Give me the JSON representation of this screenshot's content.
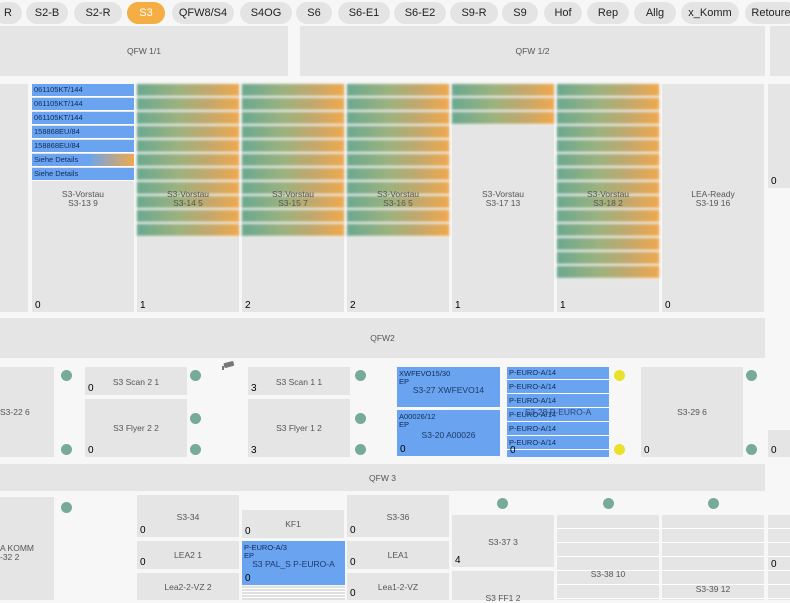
{
  "tabs": [
    {
      "label": "R"
    },
    {
      "label": "S2-B"
    },
    {
      "label": "S2-R"
    },
    {
      "label": "S3",
      "active": true
    },
    {
      "label": "QFW8/S4"
    },
    {
      "label": "S4OG"
    },
    {
      "label": "S6"
    },
    {
      "label": "S6-E1"
    },
    {
      "label": "S6-E2"
    },
    {
      "label": "S9-R"
    },
    {
      "label": "S9"
    },
    {
      "label": "Hof"
    },
    {
      "label": "Rep"
    },
    {
      "label": "Allg"
    },
    {
      "label": "x_Komm"
    },
    {
      "label": "Retoure"
    }
  ],
  "zones": {
    "qfw11": "QFW 1/1",
    "qfw12": "QFW 1/2",
    "qfw2": "QFW2",
    "qfw3": "QFW 3"
  },
  "colors": {
    "accent": "#f4ae44",
    "blue": "#6aa4f0",
    "dot": "#77aa99",
    "dot_yellow": "#e8e22a"
  },
  "lanes": [
    {
      "type": "S3-Vorstau",
      "name": "S3-13 9",
      "count": "0",
      "items": [
        "061105KT/144",
        "061105KT/144",
        "061105KT/144",
        "158868EU/84",
        "158868EU/84",
        "Siehe Details",
        "Siehe Details"
      ]
    },
    {
      "type": "S3-Vorstau",
      "name": "S3-14 5",
      "count": "1"
    },
    {
      "type": "S3-Vorstau",
      "name": "S3-15 7",
      "count": "2"
    },
    {
      "type": "S3-Vorstau",
      "name": "S3-16 5",
      "count": "2"
    },
    {
      "type": "S3-Vorstau",
      "name": "S3-17 13",
      "count": "1"
    },
    {
      "type": "S3-Vorstau",
      "name": "S3-18 2",
      "count": "1"
    },
    {
      "type": "LEA-Ready",
      "name": "S3-19 16",
      "count": "0"
    }
  ],
  "right_edge_count": "0",
  "mid": {
    "s3_22": "S3-22 6",
    "scan21": "S3 Scan 2 1",
    "scan21_count": "0",
    "flyer22": "S3 Flyer 2 2",
    "flyer22_count": "0",
    "scan11": "S3 Scan 1 1",
    "scan11_count": "3",
    "flyer12": "S3 Flyer 1 2",
    "flyer12_count": "3",
    "s3_27_head": "XWFEVO15/30",
    "s3_27_sub": "EP",
    "s3_27": "S3-27 XWFEVO14",
    "s3_20_head": "A00026/12",
    "s3_20_sub": "EP",
    "s3_20": "S3-20 A00026",
    "s3_20_count": "0",
    "euro_items": [
      "P-EURO-A/14",
      "P-EURO-A/14",
      "P-EURO-A/14",
      "P-EURO-A/14",
      "P-EURO-A/14",
      "P-EURO-A/14"
    ],
    "s3_28": "S3-28 P-EURO-A",
    "s3_28_count": "0",
    "s3_29": "S3-29 6",
    "s3_29_count": "0",
    "right_count": "0"
  },
  "bottom": {
    "kommA": "A KOMM",
    "kommB": "-32 2",
    "s3_34": "S3-34",
    "s3_34_count": "0",
    "lea21": "LEA2 1",
    "lea21_count": "0",
    "lea2vz": "Lea2-2-VZ 2",
    "kf1": "KF1",
    "kf1_count": "0",
    "pal_head": "P-EURO-A/3",
    "pal_sub": "EP",
    "pal": "S3 PAL_S P-EURO-A",
    "pal_count": "0",
    "s3_36": "S3-36",
    "s3_36_count": "0",
    "lea1": "LEA1",
    "lea1_count": "0",
    "lea1vz": "Lea1-2-VZ",
    "lea1vz_count": "0",
    "s3_37": "S3-37 3",
    "s3_37_count": "4",
    "ff1": "S3 FF1 2",
    "s3_38": "S3-38 10",
    "s3_39": "S3-39 12",
    "right_count": "0"
  }
}
